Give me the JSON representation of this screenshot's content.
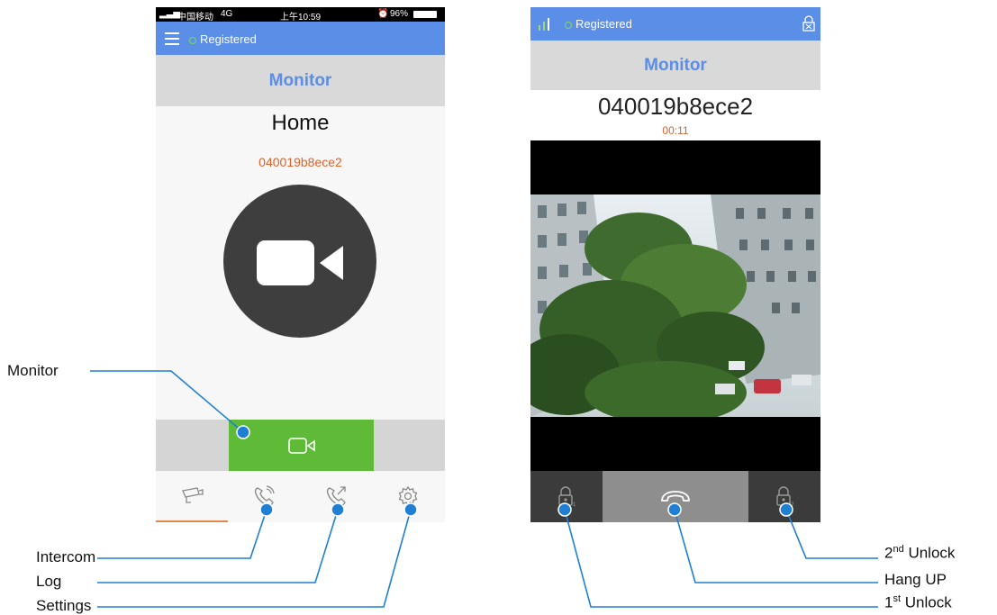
{
  "left_phone": {
    "status_bar": {
      "carrier": "中国移动",
      "network": "4G",
      "time": "上午10:59",
      "battery": "96%"
    },
    "header": {
      "status": "Registered",
      "menu_icon": "hamburger-icon"
    },
    "title": "Monitor",
    "device_name": "Home",
    "device_id": "040019b8ece2",
    "action_icon": "video-camera-icon",
    "nav": [
      {
        "icon": "cctv-camera-icon",
        "active": true
      },
      {
        "icon": "phone-intercom-icon",
        "active": false
      },
      {
        "icon": "call-log-icon",
        "active": false
      },
      {
        "icon": "gear-icon",
        "active": false
      }
    ]
  },
  "right_phone": {
    "header": {
      "status": "Registered",
      "signal_icon": "signal-icon",
      "lock_icon": "lock-icon"
    },
    "title": "Monitor",
    "device_id": "040019b8ece2",
    "duration": "00:11",
    "controls": [
      {
        "icon": "unlock-1-icon"
      },
      {
        "icon": "hang-up-icon"
      },
      {
        "icon": "unlock-2-icon"
      }
    ]
  },
  "annotations": {
    "monitor": "Monitor",
    "intercom": "Intercom",
    "log": "Log",
    "settings": "Settings",
    "unlock2_sup": "nd",
    "unlock2_rest": " Unlock",
    "unlock2_num": "2",
    "hangup": "Hang UP",
    "unlock1_num": "1",
    "unlock1_sup": "st",
    "unlock1_rest": " Unlock"
  },
  "colors": {
    "accent_blue": "#5b8ee6",
    "green": "#5fba38",
    "orange": "#d9622b",
    "callout": "#1e7fd4"
  }
}
